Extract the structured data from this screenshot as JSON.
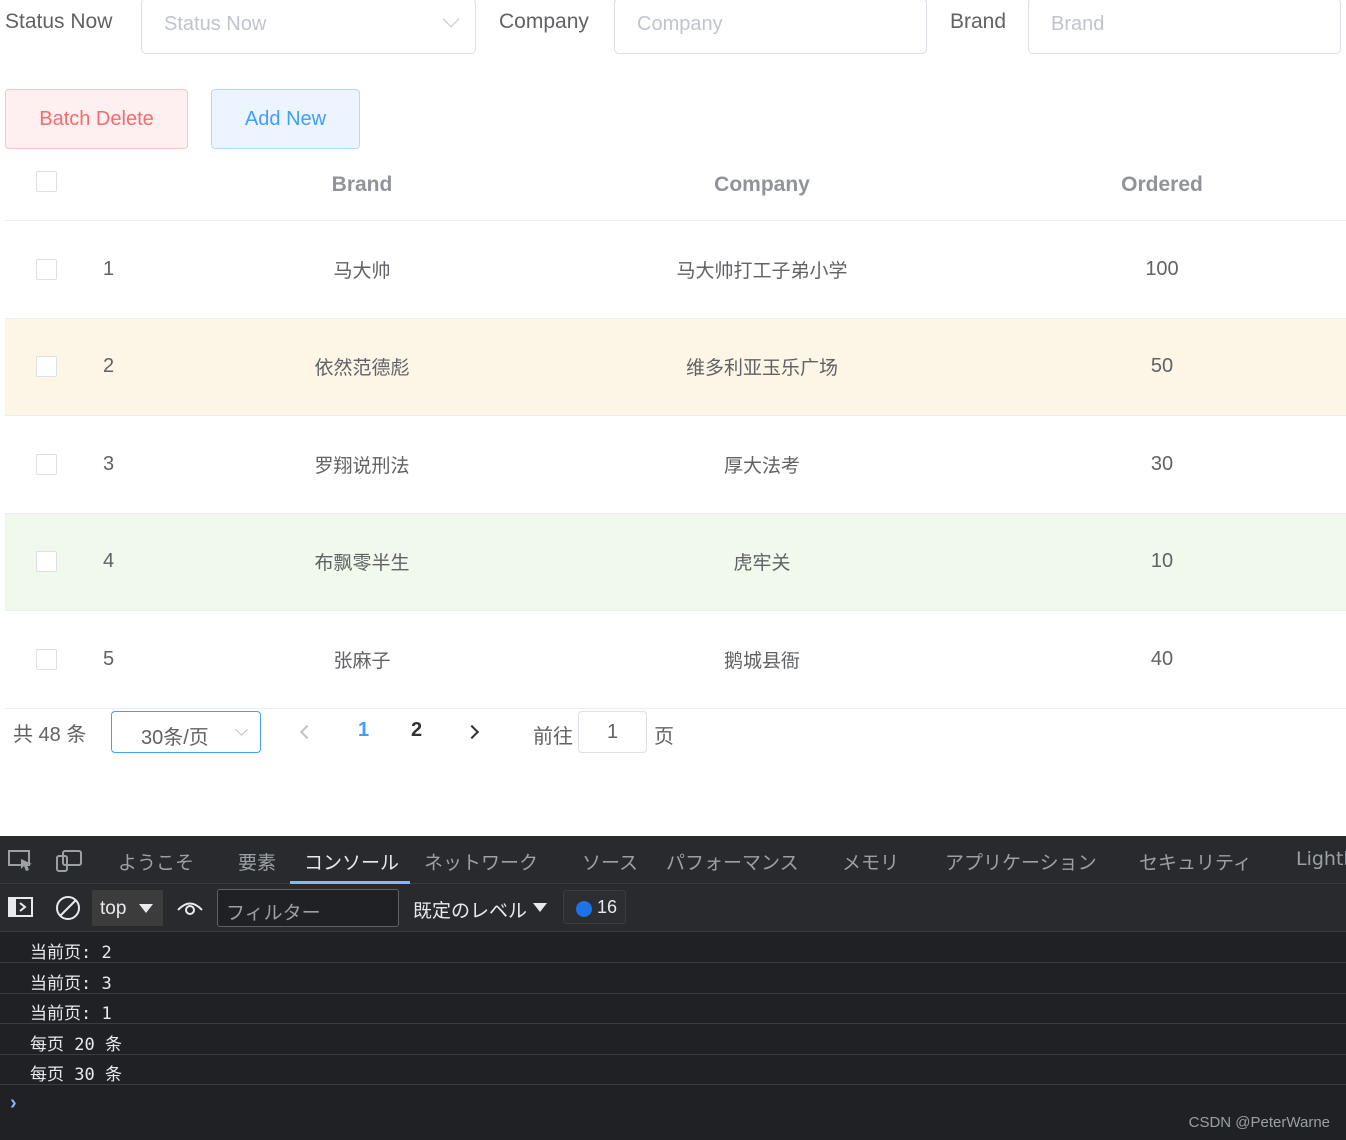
{
  "filters": {
    "status_label": "Status Now",
    "status_placeholder": "Status Now",
    "company_label": "Company",
    "company_placeholder": "Company",
    "brand_label": "Brand",
    "brand_placeholder": "Brand"
  },
  "actions": {
    "batch_delete": "Batch Delete",
    "add_new": "Add New"
  },
  "table": {
    "headers": {
      "brand": "Brand",
      "company": "Company",
      "ordered": "Ordered"
    },
    "rows": [
      {
        "index": "1",
        "brand": "马大帅",
        "company": "马大帅打工子弟小学",
        "ordered": "100",
        "highlight": "none"
      },
      {
        "index": "2",
        "brand": "依然范德彪",
        "company": "维多利亚玉乐广场",
        "ordered": "50",
        "highlight": "warning"
      },
      {
        "index": "3",
        "brand": "罗翔说刑法",
        "company": "厚大法考",
        "ordered": "30",
        "highlight": "none"
      },
      {
        "index": "4",
        "brand": "布飘零半生",
        "company": "虎牢关",
        "ordered": "10",
        "highlight": "success"
      },
      {
        "index": "5",
        "brand": "张麻子",
        "company": "鹅城县衙",
        "ordered": "40",
        "highlight": "none"
      }
    ]
  },
  "pagination": {
    "total": "共 48 条",
    "page_size": "30条/页",
    "pages": [
      "1",
      "2"
    ],
    "current_page": "1",
    "goto_label": "前往",
    "goto_value": "1",
    "goto_suffix": "页"
  },
  "devtools": {
    "tabs": [
      "ようこそ",
      "要素",
      "コンソール",
      "ネットワーク",
      "ソース",
      "パフォーマンス",
      "メモリ",
      "アプリケーション",
      "セキュリティ",
      "Lighth"
    ],
    "active_tab": "コンソール",
    "context": "top",
    "filter_placeholder": "フィルター",
    "level": "既定のレベル",
    "message_count": "16",
    "logs": [
      "当前页: 2",
      "当前页: 3",
      "当前页: 1",
      "每页 20 条",
      "每页 30 条"
    ]
  },
  "watermark": "CSDN @PeterWarne",
  "colors": {
    "accent": "#409eff",
    "danger": "#f56c6c",
    "warning_row": "#fdf5e6",
    "success_row": "#f0f9eb",
    "devtools_bg": "#202124"
  }
}
